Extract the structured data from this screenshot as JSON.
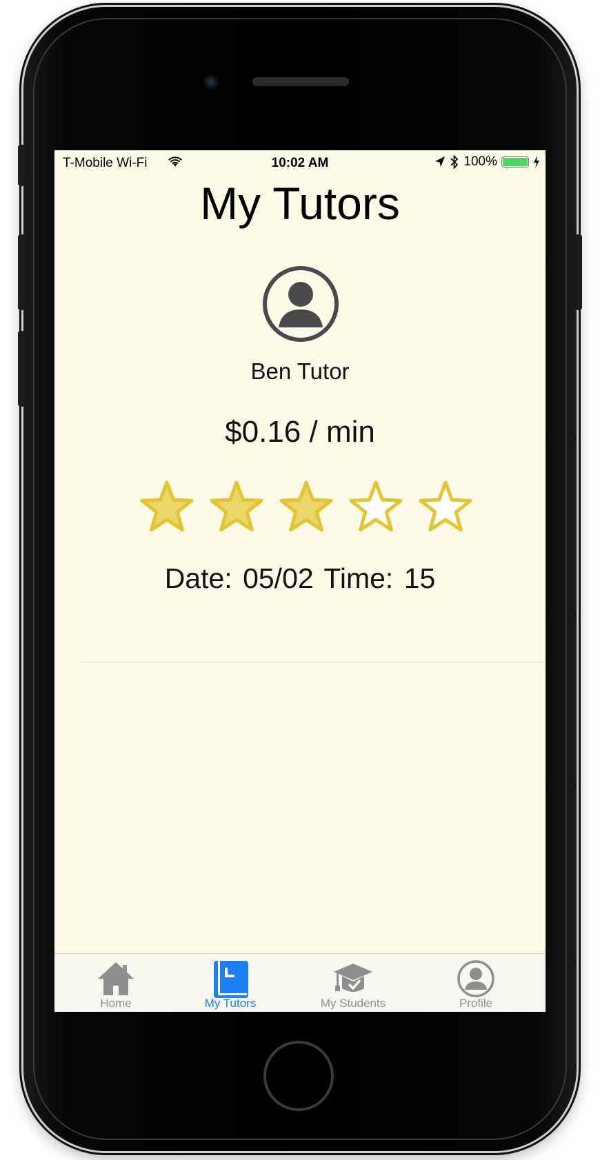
{
  "status_bar": {
    "carrier": "T-Mobile Wi-Fi",
    "time": "10:02 AM",
    "battery": "100%"
  },
  "page": {
    "title": "My Tutors"
  },
  "tutor": {
    "name": "Ben Tutor",
    "rate": "$0.16 / min",
    "rating": 3,
    "rating_max": 5,
    "date_time": "Date: 05/02  Time: 15"
  },
  "tab_bar": {
    "tabs": [
      {
        "label": "Home",
        "icon": "home-icon"
      },
      {
        "label": "My Tutors",
        "icon": "book-icon"
      },
      {
        "label": "My Students",
        "icon": "graduation-cap-icon"
      },
      {
        "label": "Profile",
        "icon": "profile-icon"
      }
    ],
    "active_index": 1
  },
  "colors": {
    "screen_background": "#fdfbe7",
    "star_fill": "#ebd66c",
    "star_stroke": "#e3c432",
    "active_tab": "#1c7ff2",
    "inactive_tab": "#8e8e8e"
  }
}
